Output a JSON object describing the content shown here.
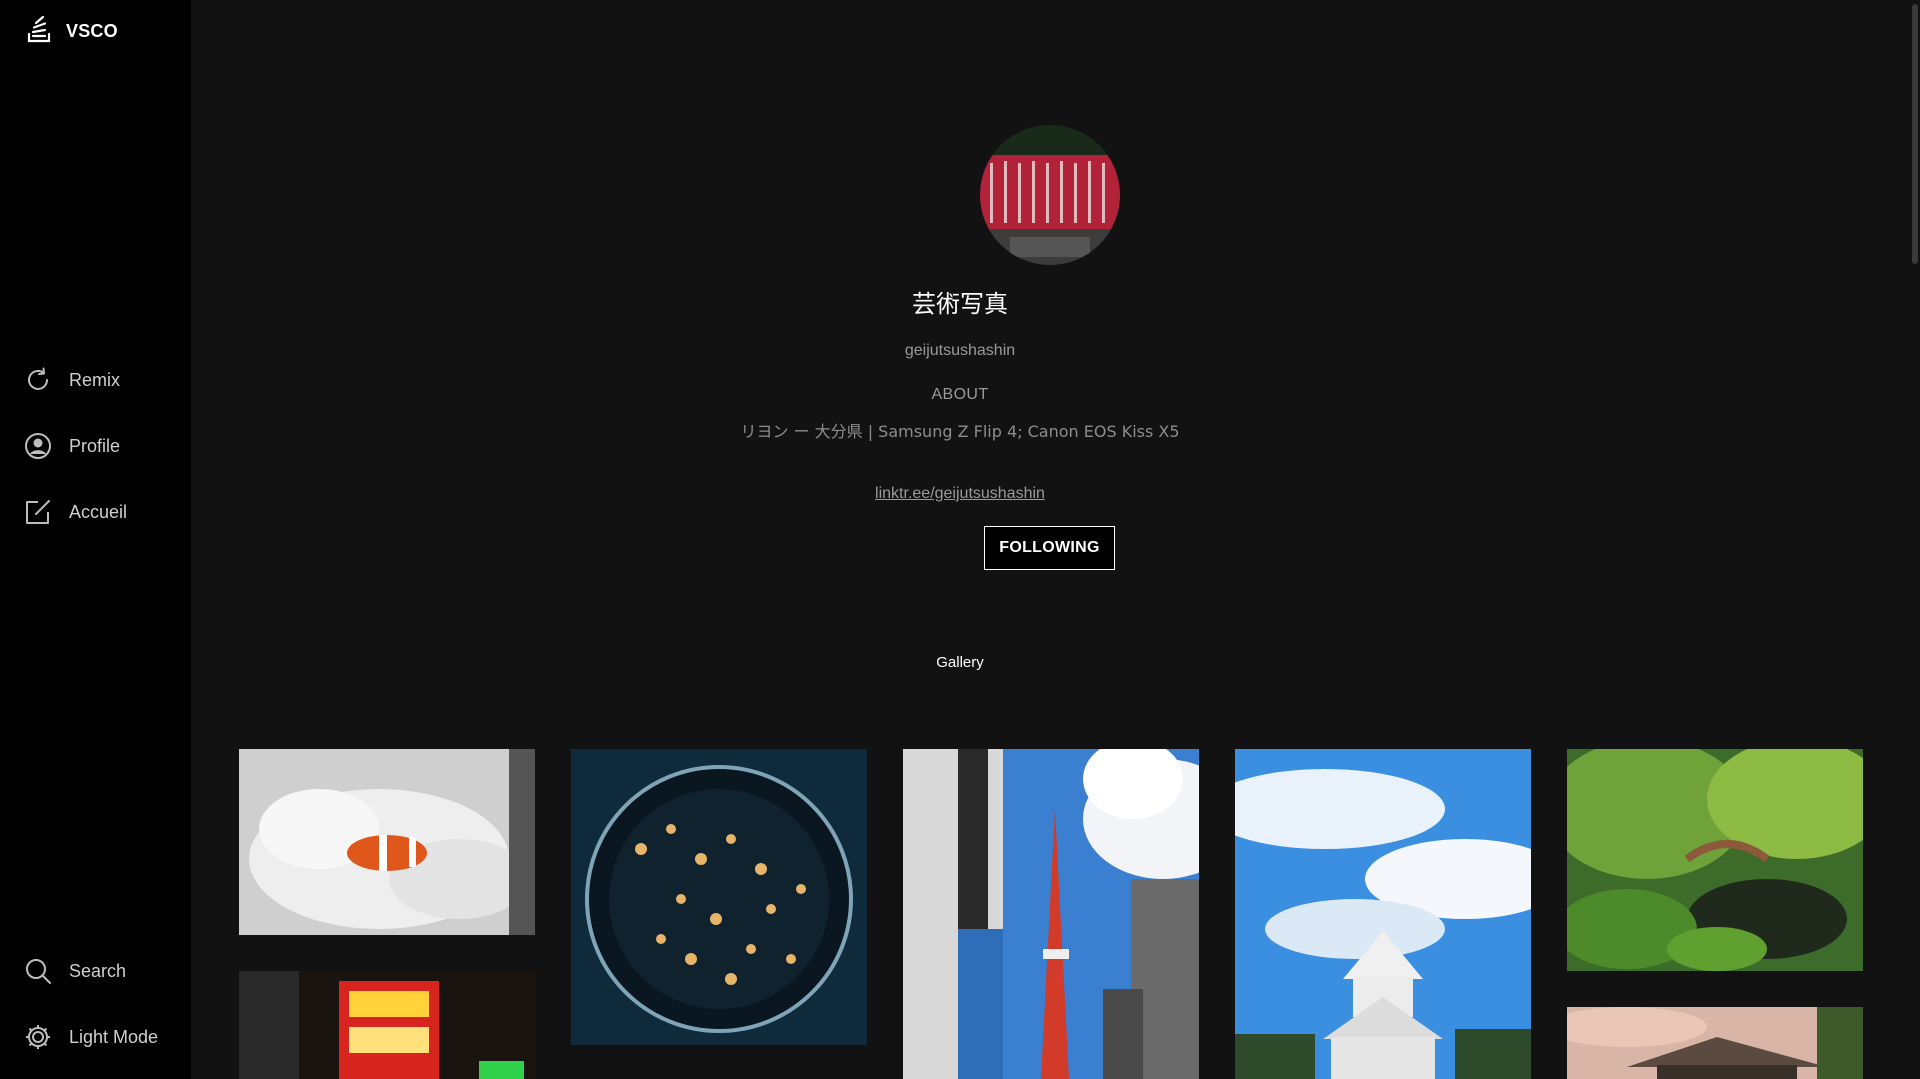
{
  "sidebar": {
    "brand": {
      "label": "VSCO",
      "icon": "vsco-stack-icon"
    },
    "items": [
      {
        "label": "Remix",
        "icon": "refresh-icon"
      },
      {
        "label": "Profile",
        "icon": "user-circle-icon"
      },
      {
        "label": "Accueil",
        "icon": "edit-square-icon"
      },
      {
        "label": "Search",
        "icon": "search-icon"
      },
      {
        "label": "Light Mode",
        "icon": "gear-icon"
      }
    ]
  },
  "profile": {
    "display_name": "芸術写真",
    "username": "geijutsushashin",
    "about_title": "ABOUT",
    "about_text": "リヨン ー 大分県 | Samsung Z Flip 4; Canon EOS Kiss X5",
    "link": "linktr.ee/geijutsushashin",
    "follow_button": "FOLLOWING"
  },
  "gallery": {
    "tab_label": "Gallery",
    "photos": [
      {
        "subject": "clownfish in white anemone"
      },
      {
        "subject": "jellyfish in round aquarium"
      },
      {
        "subject": "Tokyo Tower between buildings"
      },
      {
        "subject": "Osaka Castle under blue sky"
      },
      {
        "subject": "Japanese garden with bridge"
      },
      {
        "subject": "neon pachinko signs at night"
      },
      {
        "subject": "traditional roof at sunset"
      }
    ]
  },
  "colors": {
    "background": "#121212",
    "sidebar": "#000000",
    "text_primary": "#ffffff",
    "text_muted": "#9a9a9a"
  }
}
